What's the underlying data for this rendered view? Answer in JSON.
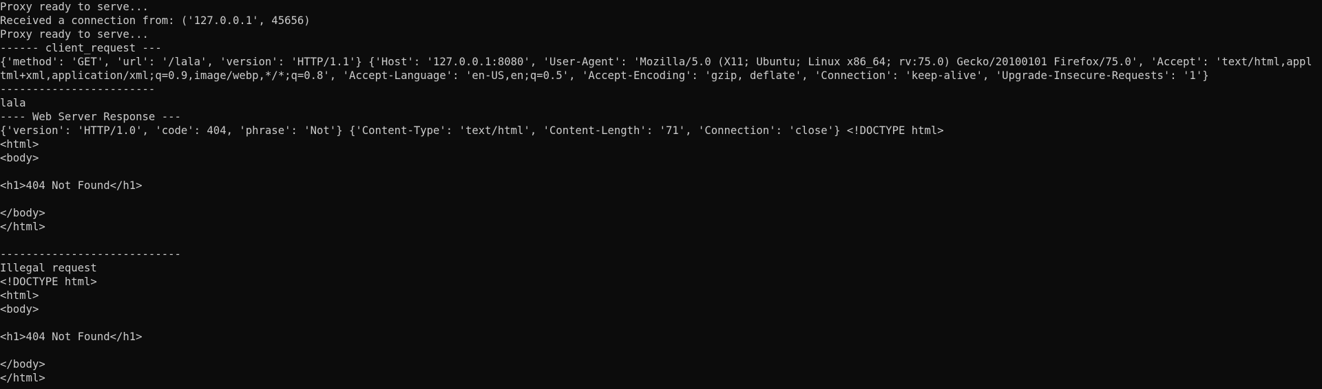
{
  "terminal": {
    "lines": [
      "Proxy ready to serve...",
      "Received a connection from: ('127.0.0.1', 45656)",
      "Proxy ready to serve...",
      "------ client_request ---",
      "{'method': 'GET', 'url': '/lala', 'version': 'HTTP/1.1'} {'Host': '127.0.0.1:8080', 'User-Agent': 'Mozilla/5.0 (X11; Ubuntu; Linux x86_64; rv:75.0) Gecko/20100101 Firefox/75.0', 'Accept': 'text/html,application/x",
      "tml+xml,application/xml;q=0.9,image/webp,*/*;q=0.8', 'Accept-Language': 'en-US,en;q=0.5', 'Accept-Encoding': 'gzip, deflate', 'Connection': 'keep-alive', 'Upgrade-Insecure-Requests': '1'}",
      "------------------------",
      "lala",
      "---- Web Server Response ---",
      "{'version': 'HTTP/1.0', 'code': 404, 'phrase': 'Not'} {'Content-Type': 'text/html', 'Content-Length': '71', 'Connection': 'close'} <!DOCTYPE html>",
      "<html>",
      "<body>",
      "",
      "<h1>404 Not Found</h1>",
      "",
      "</body>",
      "</html>",
      "",
      "----------------------------",
      "Illegal request",
      "<!DOCTYPE html>",
      "<html>",
      "<body>",
      "",
      "<h1>404 Not Found</h1>",
      "",
      "</body>",
      "</html>"
    ]
  },
  "colors": {
    "background": "#0c0c0c",
    "text": "#cccccc"
  }
}
